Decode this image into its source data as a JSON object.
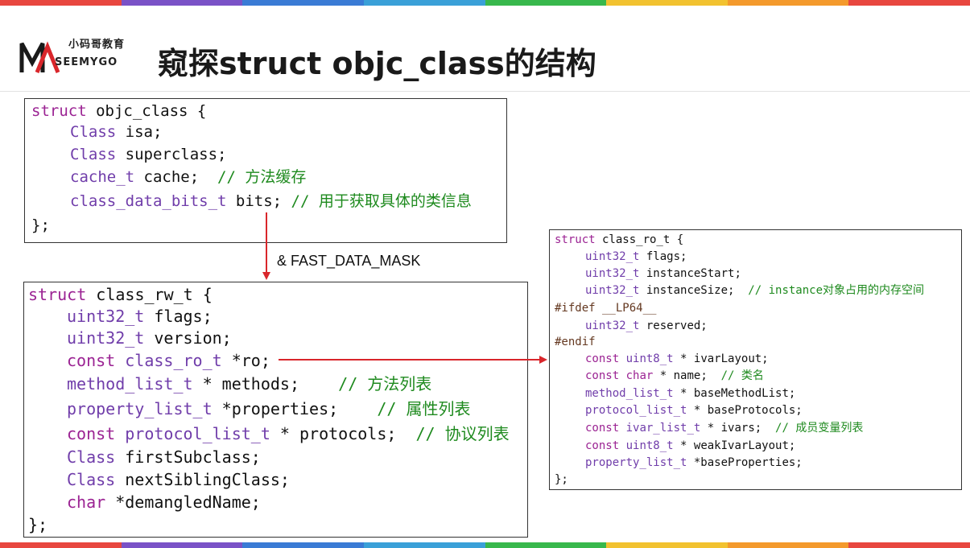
{
  "stripe_colors": [
    "#e8473f",
    "#7a52c7",
    "#3a7bd5",
    "#3aa0d8",
    "#38b84c",
    "#f2c230",
    "#f49a2c",
    "#e8473f"
  ],
  "header": {
    "logo_cn": "小码哥教育",
    "logo_en": "SEEMYGO",
    "title": "窥探struct objc_class的结构"
  },
  "arrow_label": "& FAST_DATA_MASK",
  "objc_class": {
    "line1_kw": "struct",
    "line1_rest": " objc_class {",
    "line2_ty": "Class",
    "line2_rest": " isa;",
    "line3_ty": "Class",
    "line3_rest": " superclass;",
    "line4_ty": "cache_t",
    "line4_rest": " cache;  ",
    "line4_cm": "// 方法缓存",
    "line5_ty": "class_data_bits_t",
    "line5_rest": " bits; ",
    "line5_cm": "// 用于获取具体的类信息",
    "line6": "};"
  },
  "class_rw_t": {
    "l1_kw": "struct",
    "l1_rest": " class_rw_t {",
    "l2_ty": "uint32_t",
    "l2_rest": " flags;",
    "l3_ty": "uint32_t",
    "l3_rest": " version;",
    "l4_kw": "const",
    "l4_sp": " ",
    "l4_ty": "class_ro_t",
    "l4_rest": " *ro;",
    "l5_ty": "method_list_t",
    "l5_rest": " * methods;    ",
    "l5_cm": "// 方法列表",
    "l6_ty": "property_list_t",
    "l6_rest": " *properties;    ",
    "l6_cm": "// 属性列表",
    "l7_kw": "const",
    "l7_sp": " ",
    "l7_ty": "protocol_list_t",
    "l7_rest": " * protocols;  ",
    "l7_cm": "// 协议列表",
    "l8_ty": "Class",
    "l8_rest": " firstSubclass;",
    "l9_ty": "Class",
    "l9_rest": " nextSiblingClass;",
    "l10_kw": "char",
    "l10_rest": " *demangledName;",
    "l11": "};"
  },
  "class_ro_t": {
    "l1_kw": "struct",
    "l1_rest": " class_ro_t {",
    "l2_ty": "uint32_t",
    "l2_rest": " flags;",
    "l3_ty": "uint32_t",
    "l3_rest": " instanceStart;",
    "l4_ty": "uint32_t",
    "l4_rest": " instanceSize;  ",
    "l4_cm": "// instance对象占用的内存空间",
    "l5_pp": "#ifdef __LP64__",
    "l6_ty": "uint32_t",
    "l6_rest": " reserved;",
    "l7_pp": "#endif",
    "l8_kw": "const",
    "l8_sp": " ",
    "l8_ty": "uint8_t",
    "l8_rest": " * ivarLayout;",
    "l9_kw": "const",
    "l9_sp": " ",
    "l9_ty": "char",
    "l9_rest": " * name;  ",
    "l9_cm": "// 类名",
    "l10_ty": "method_list_t",
    "l10_rest": " * baseMethodList;",
    "l11_ty": "protocol_list_t",
    "l11_rest": " * baseProtocols;",
    "l12_kw": "const",
    "l12_sp": " ",
    "l12_ty": "ivar_list_t",
    "l12_rest": " * ivars;  ",
    "l12_cm": "// 成员变量列表",
    "l13_kw": "const",
    "l13_sp": " ",
    "l13_ty": "uint8_t",
    "l13_rest": " * weakIvarLayout;",
    "l14_ty": "property_list_t",
    "l14_rest": " *baseProperties;",
    "l15": "};"
  },
  "colors": {
    "arrow": "#d9262b",
    "keyword": "#9b2393",
    "type": "#703daa",
    "comment": "#1e8a1e"
  }
}
